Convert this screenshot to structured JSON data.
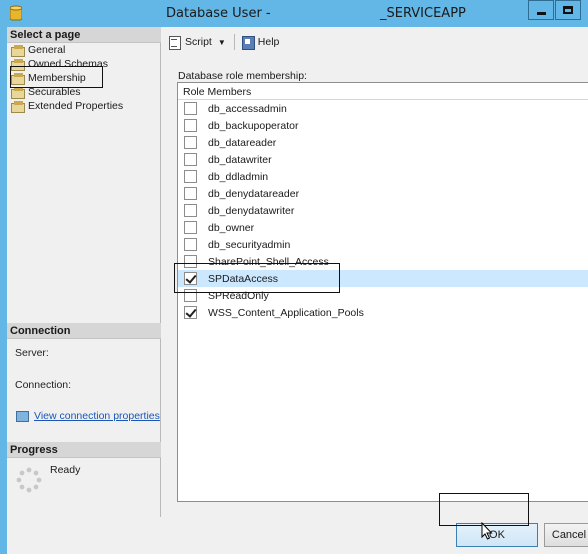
{
  "window": {
    "title": "Database User -",
    "title_suffix": "_SERVICEAPP"
  },
  "left": {
    "select_page_header": "Select a page",
    "pages": [
      {
        "label": "General"
      },
      {
        "label": "Owned Schemas"
      },
      {
        "label": "Membership"
      },
      {
        "label": "Securables"
      },
      {
        "label": "Extended Properties"
      }
    ],
    "connection_header": "Connection",
    "server_label": "Server:",
    "connection_label": "Connection:",
    "view_connection_link": "View connection properties",
    "progress_header": "Progress",
    "progress_status": "Ready"
  },
  "toolbar": {
    "script_label": "Script",
    "help_label": "Help"
  },
  "roles": {
    "group_label": "Database role membership:",
    "column_header": "Role Members",
    "items": [
      {
        "name": "db_accessadmin",
        "checked": false
      },
      {
        "name": "db_backupoperator",
        "checked": false
      },
      {
        "name": "db_datareader",
        "checked": false
      },
      {
        "name": "db_datawriter",
        "checked": false
      },
      {
        "name": "db_ddladmin",
        "checked": false
      },
      {
        "name": "db_denydatareader",
        "checked": false
      },
      {
        "name": "db_denydatawriter",
        "checked": false
      },
      {
        "name": "db_owner",
        "checked": false
      },
      {
        "name": "db_securityadmin",
        "checked": false
      },
      {
        "name": "SharePoint_Shell_Access",
        "checked": false
      },
      {
        "name": "SPDataAccess",
        "checked": true,
        "selected": true
      },
      {
        "name": "SPReadOnly",
        "checked": false
      },
      {
        "name": "WSS_Content_Application_Pools",
        "checked": true
      }
    ]
  },
  "buttons": {
    "ok_label": "OK",
    "cancel_label": "Cancel"
  },
  "colors": {
    "title_bar": "#63b7e6",
    "selected_row": "#cce8ff",
    "link": "#1a56b8"
  }
}
